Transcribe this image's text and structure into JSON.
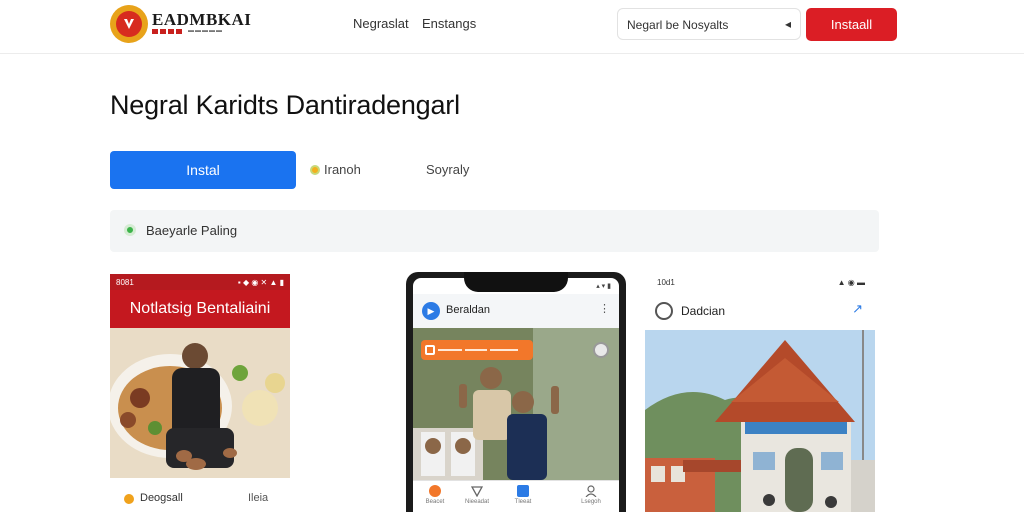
{
  "header": {
    "brand": "EADMBKAI",
    "nav": [
      "Negraslat",
      "Enstangs"
    ],
    "search_placeholder": "Negarl be Nosyalts",
    "search_arrow": "◂",
    "install_label": "Instaall"
  },
  "main": {
    "title": "Negral Karidts Dantiradengarl",
    "install_label": "Instal",
    "link1": "Iranoh",
    "link2": "Soyraly",
    "info_label": "Baeyarle Paling"
  },
  "cards": {
    "c1": {
      "status_left": "8081",
      "status_right": "▪ ◆ ◉ ✕ ▲ ▮",
      "banner": "Notlatsig Bentaliaini",
      "footer_label": "Deogsall",
      "footer_extra": "Ileia"
    },
    "c2": {
      "title": "Beraldan",
      "more": "⋮",
      "status": "▴ ▾ ▮",
      "tabs": [
        "Beacet",
        "Nieeadat",
        "Tleeat",
        "Lsegoh"
      ]
    },
    "c3": {
      "status_left": "10d1",
      "status_right": "▲ ◉ ▬",
      "title": "Dadcian",
      "action": "↗"
    }
  },
  "colors": {
    "brand_red": "#db1e25",
    "primary_blue": "#1a73f0",
    "info_bg": "#f3f5f6",
    "logo_orange": "#e8a31a"
  }
}
